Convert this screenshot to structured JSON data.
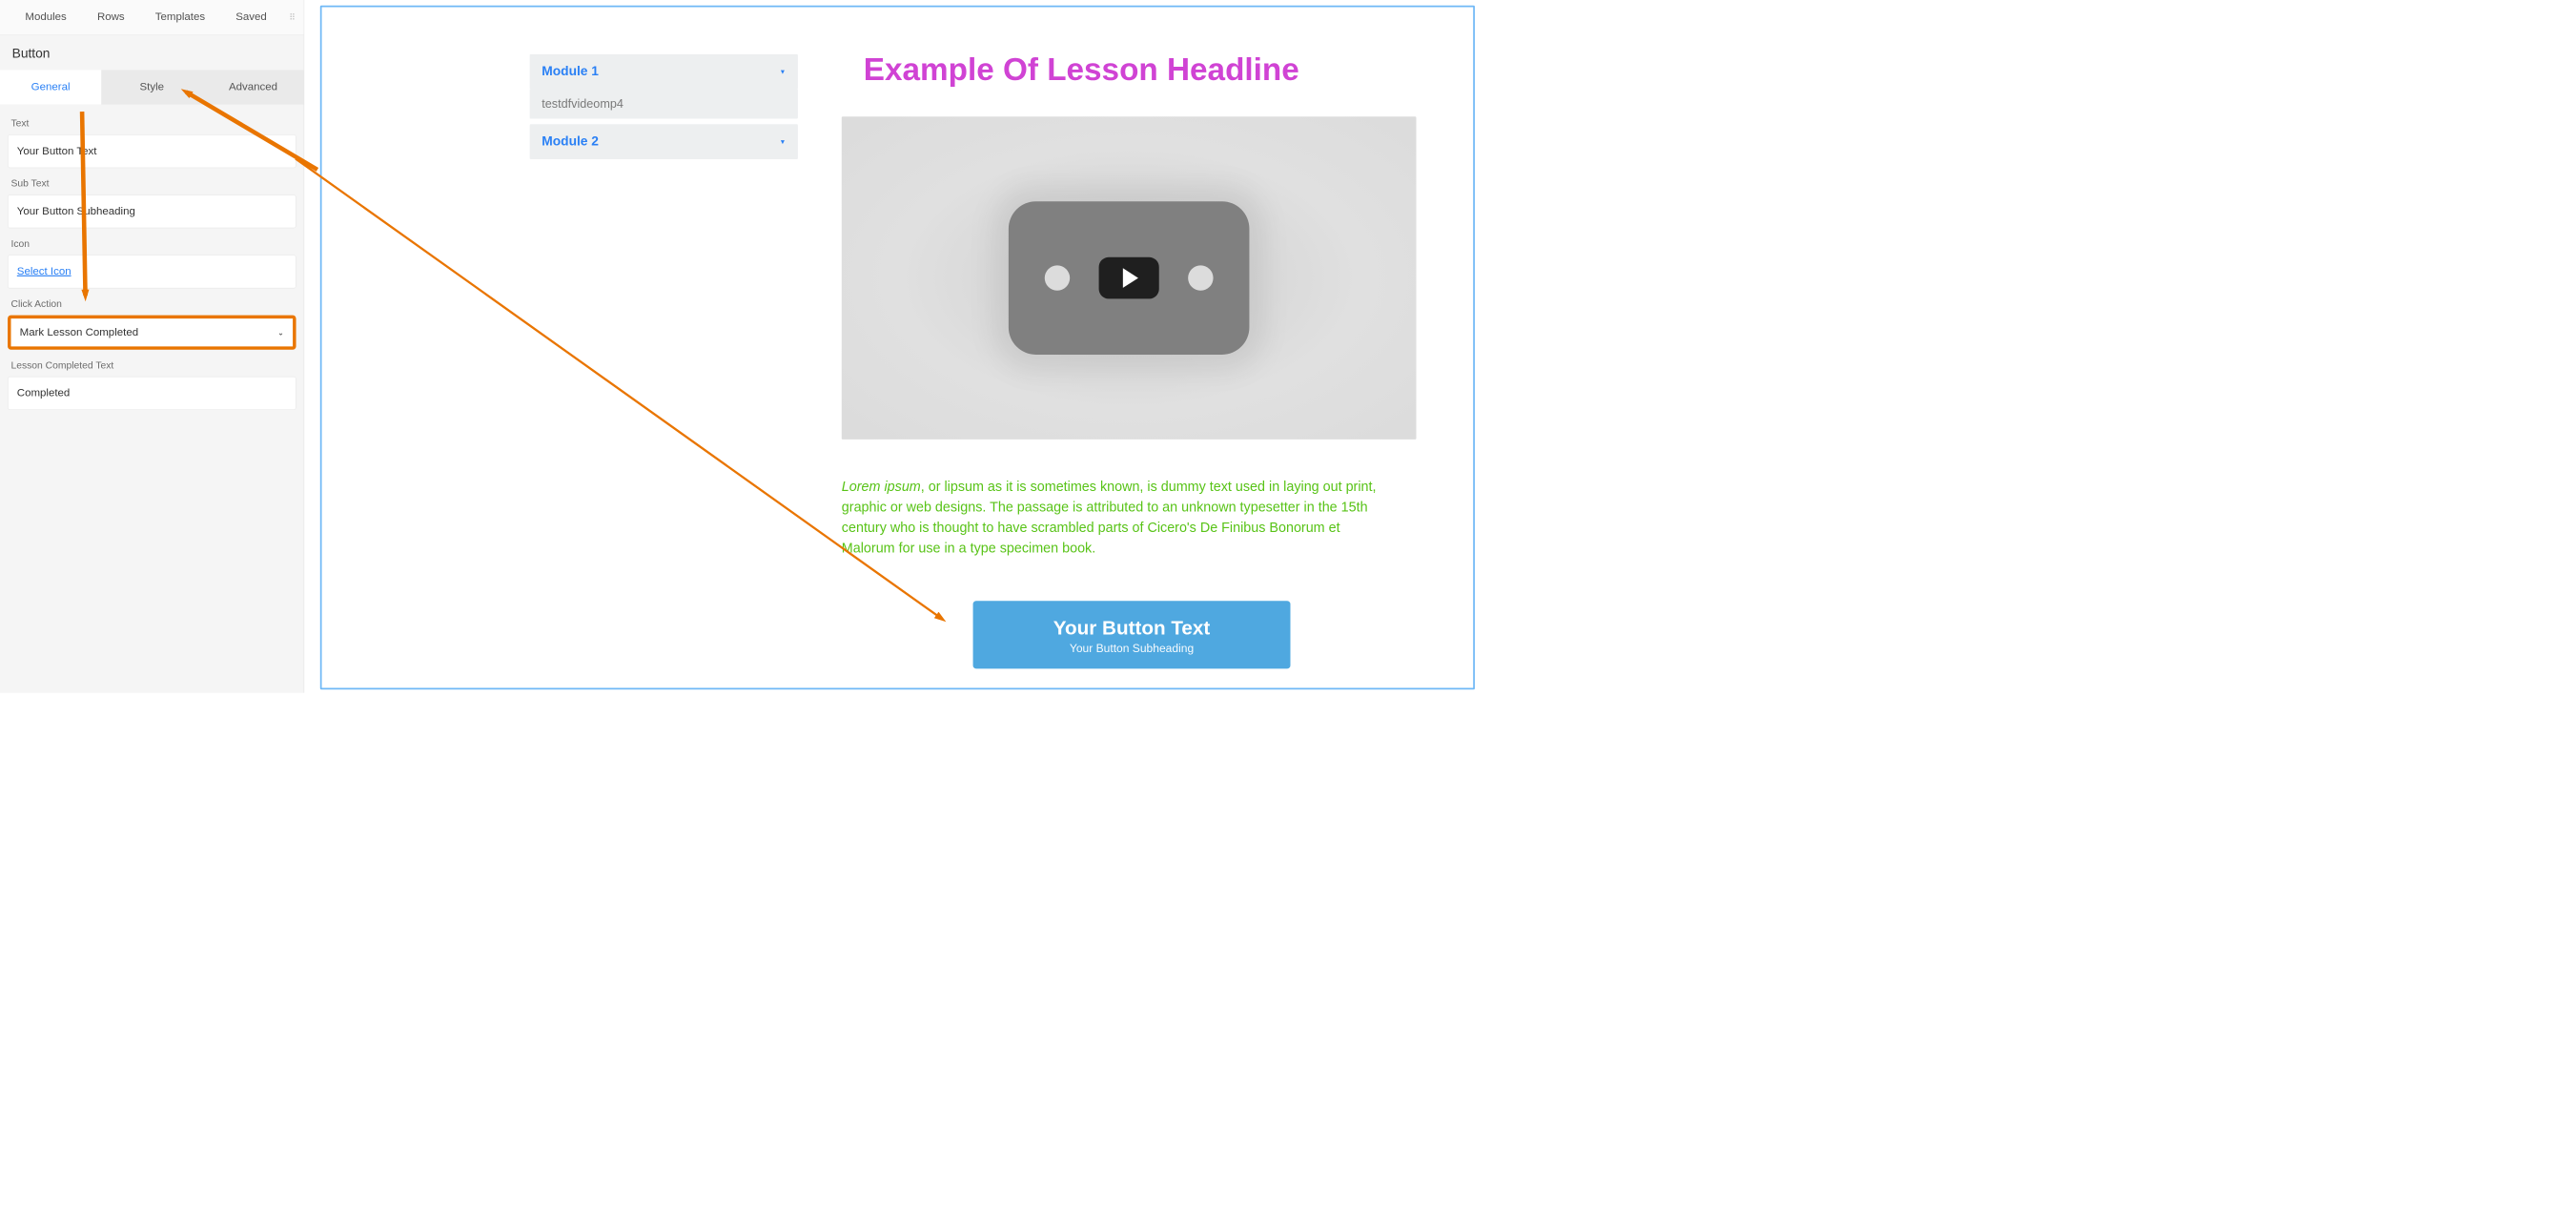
{
  "breadcrumb": "testdfvideomp4",
  "top_tabs": {
    "modules": "Modules",
    "rows": "Rows",
    "templates": "Templates",
    "saved": "Saved"
  },
  "module_title": "Button",
  "sub_tabs": {
    "general": "General",
    "style": "Style",
    "advanced": "Advanced"
  },
  "fields": {
    "text_label": "Text",
    "text_value": "Your Button Text",
    "subtext_label": "Sub Text",
    "subtext_value": "Your Button Subheading",
    "icon_label": "Icon",
    "icon_value": "Select Icon",
    "click_action_label": "Click Action",
    "click_action_value": "Mark Lesson Completed",
    "completed_label": "Lesson Completed Text",
    "completed_value": "Completed"
  },
  "modules": {
    "m1": "Module 1",
    "m1_sub": "testdfvideomp4",
    "m2": "Module 2"
  },
  "headline": "Example Of Lesson Headline",
  "lorem_em": "Lorem ipsum",
  "lorem_rest": ", or lipsum as it is sometimes known, is dummy text used in laying out print, graphic or web designs. The passage is attributed to an unknown typesetter in the 15th century who is thought to have scrambled parts of Cicero's De Finibus Bonorum et Malorum for use in a type specimen book.",
  "button": {
    "title": "Your Button Text",
    "sub": "Your Button Subheading"
  }
}
